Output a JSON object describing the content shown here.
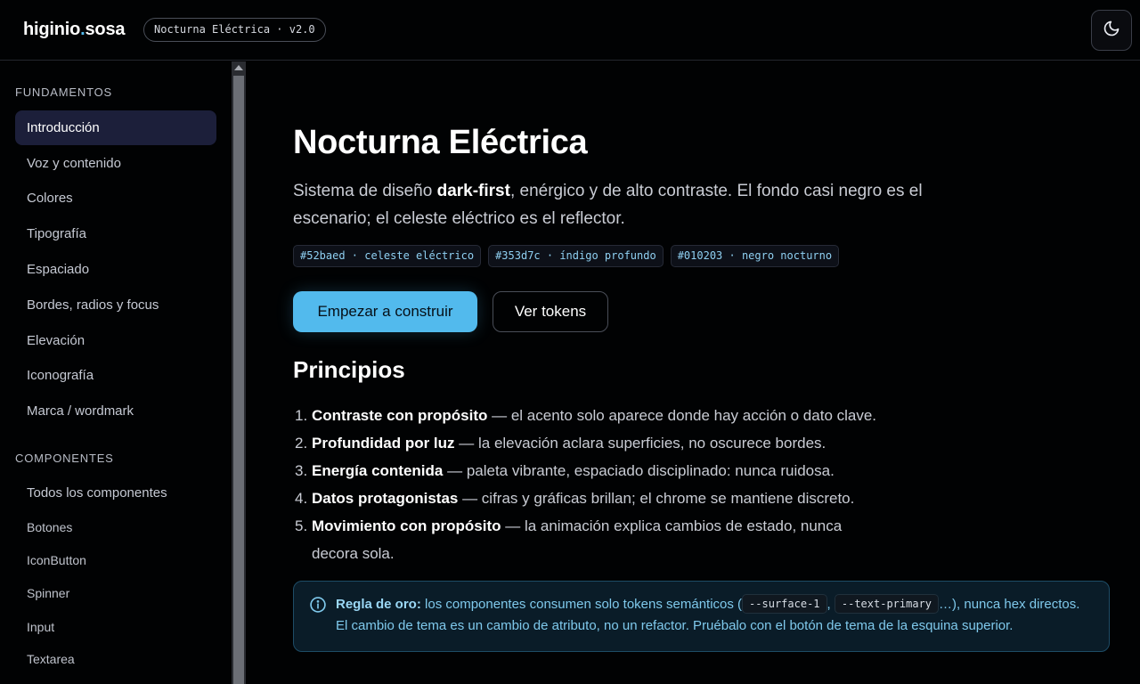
{
  "header": {
    "brand_main": "higinio",
    "brand_dot": ".",
    "brand_rest": "sosa",
    "version": "Nocturna Eléctrica · v2.0",
    "theme_icon": "moon-icon"
  },
  "sidebar": {
    "sections": [
      {
        "title": "FUNDAMENTOS"
      },
      {
        "title": "COMPONENTES"
      }
    ],
    "fundamentos": [
      "Introducción",
      "Voz y contenido",
      "Colores",
      "Tipografía",
      "Espaciado",
      "Bordes, radios y focus",
      "Elevación",
      "Iconografía",
      "Marca / wordmark"
    ],
    "componentes": [
      "Todos los componentes"
    ],
    "subitems": [
      "Botones",
      "IconButton",
      "Spinner",
      "Input",
      "Textarea"
    ],
    "active": "Introducción"
  },
  "main": {
    "title": "Nocturna Eléctrica",
    "subtitle_pre": "Sistema de diseño ",
    "subtitle_bold": "dark-first",
    "subtitle_post": ", enérgico y de alto contraste. El fondo casi negro es el escenario; el celeste eléctrico es el reflector.",
    "tokens": [
      "#52baed · celeste eléctrico",
      "#353d7c · índigo profundo",
      "#010203 · negro nocturno"
    ],
    "primary_button": "Empezar a construir",
    "secondary_button": "Ver tokens",
    "principles_title": "Principios",
    "principles": [
      {
        "num": "1.",
        "bold": "Contraste con propósito",
        "text": " — el acento solo aparece donde hay acción o dato clave."
      },
      {
        "num": "2.",
        "bold": "Profundidad por luz",
        "text": " — la elevación aclara superficies, no oscurece bordes."
      },
      {
        "num": "3.",
        "bold": "Energía contenida",
        "text": " — paleta vibrante, espaciado disciplinado: nunca ruidosa."
      },
      {
        "num": "4.",
        "bold": "Datos protagonistas",
        "text": " — cifras y gráficas brillan; el chrome se mantiene discreto."
      },
      {
        "num": "5.",
        "bold": "Movimiento con propósito",
        "text": " — la animación explica cambios de estado, nunca decora sola."
      }
    ],
    "callout": {
      "icon": "info-icon",
      "bold": "Regla de oro:",
      "text1": " los componentes consumen solo tokens semánticos (",
      "code1": "--surface-1",
      "sep": ",",
      "code2": "--text-primary",
      "text2": "…), nunca hex directos. El cambio de tema es un cambio de atributo, no un refactor. Pruébalo con el botón de tema de la esquina superior."
    }
  },
  "colors": {
    "accent": "#52baed",
    "indigo": "#353d7c",
    "background": "#010203"
  }
}
